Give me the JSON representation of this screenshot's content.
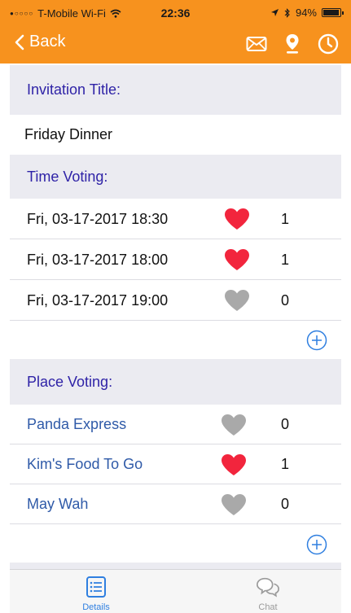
{
  "status_bar": {
    "carrier": "T-Mobile Wi-Fi",
    "time": "22:36",
    "battery": "94%"
  },
  "nav": {
    "back_label": "Back",
    "icons": [
      "mail-icon",
      "location-pin-icon",
      "clock-icon"
    ]
  },
  "invitation": {
    "section_title": "Invitation Title:",
    "title_value": "Friday Dinner"
  },
  "time_voting": {
    "section_title": "Time Voting:",
    "options": [
      {
        "label": "Fri, 03-17-2017 18:30",
        "voted": true,
        "count": "1"
      },
      {
        "label": "Fri, 03-17-2017 18:00",
        "voted": true,
        "count": "1"
      },
      {
        "label": "Fri, 03-17-2017 19:00",
        "voted": false,
        "count": "0"
      }
    ]
  },
  "place_voting": {
    "section_title": "Place Voting:",
    "options": [
      {
        "label": "Panda Express",
        "voted": false,
        "count": "0"
      },
      {
        "label": "Kim's Food To Go",
        "voted": true,
        "count": "1"
      },
      {
        "label": "May Wah",
        "voted": false,
        "count": "0"
      }
    ]
  },
  "tabs": [
    {
      "label": "Details",
      "icon": "list-icon",
      "active": true
    },
    {
      "label": "Chat",
      "icon": "chat-bubbles-icon",
      "active": false
    }
  ],
  "colors": {
    "nav_bar": "#f7921e",
    "section_title": "#2f23a7",
    "heart_voted": "#f2253d",
    "heart_unvoted": "#a9a9a9",
    "accent_blue": "#2f7fe0",
    "tab_inactive": "#9a9a9a"
  }
}
